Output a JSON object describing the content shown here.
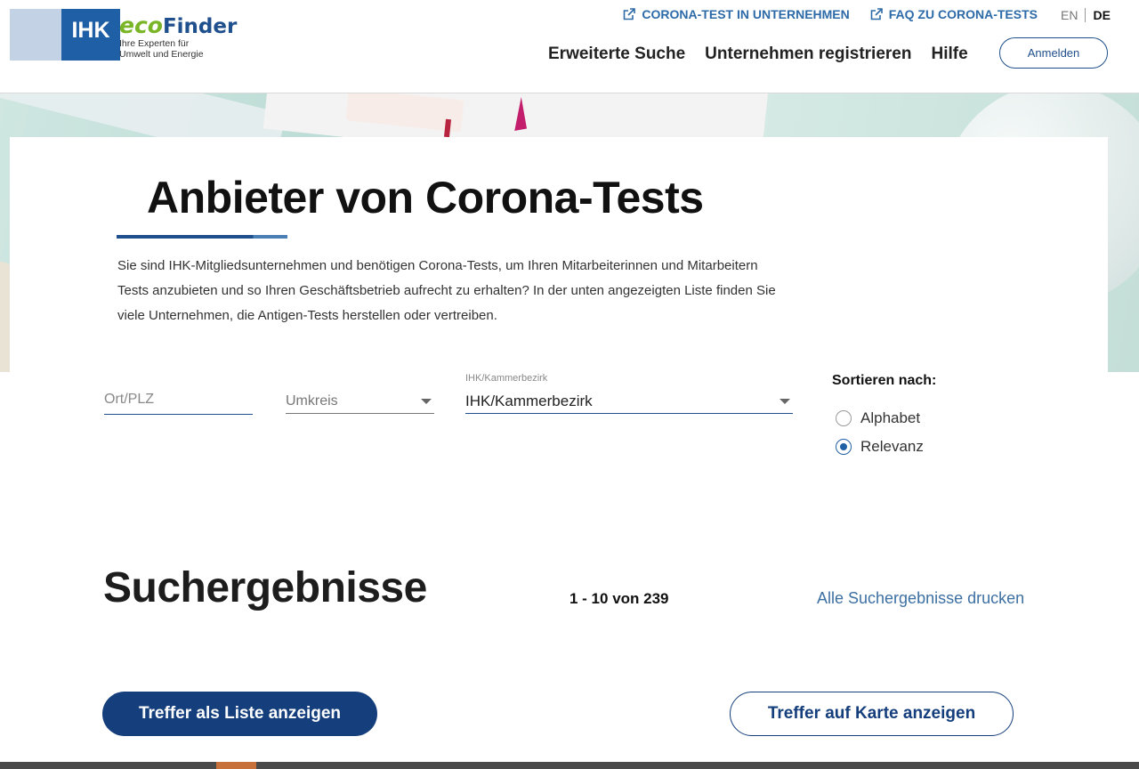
{
  "brand": {
    "logo_ihk": "IHK",
    "logo_eco": "eco",
    "logo_finder": "Finder",
    "tagline_line1": "Ihre Experten für",
    "tagline_line2": "Umwelt und Energie",
    "primary_color": "#1f4f8c",
    "accent_color": "#7ab527"
  },
  "header": {
    "top_links": [
      {
        "label": "CORONA-TEST IN UNTERNEHMEN",
        "icon": "external-link-icon"
      },
      {
        "label": "FAQ ZU CORONA-TESTS",
        "icon": "external-link-icon"
      }
    ],
    "lang_en": "EN",
    "lang_de": "DE",
    "nav": [
      "Erweiterte Suche",
      "Unternehmen registrieren",
      "Hilfe"
    ],
    "login_label": "Anmelden"
  },
  "hero": {
    "title": "Anbieter von Corona-Tests",
    "intro": "Sie sind IHK-Mitgliedsunternehmen und benötigen Corona-Tests, um Ihren Mitarbeiterinnen und Mitarbeitern Tests anzubieten und so Ihren Geschäftsbetrieb aufrecht zu erhalten? In der unten angezeigten Liste finden Sie viele Unternehmen, die Antigen-Tests herstellen oder vertreiben."
  },
  "filters": {
    "ort_placeholder": "Ort/PLZ",
    "umkreis_value": "Umkreis",
    "ihk_label": "IHK/Kammerbezirk",
    "ihk_value": "IHK/Kammerbezirk",
    "sort_title": "Sortieren nach:",
    "sort_options": [
      "Alphabet",
      "Relevanz"
    ],
    "sort_selected": "Relevanz"
  },
  "results": {
    "title": "Suchergebnisse",
    "count": "1 - 10 von 239",
    "print_label": "Alle Suchergebnisse drucken",
    "list_button": "Treffer als Liste anzeigen",
    "map_button": "Treffer auf Karte anzeigen"
  }
}
